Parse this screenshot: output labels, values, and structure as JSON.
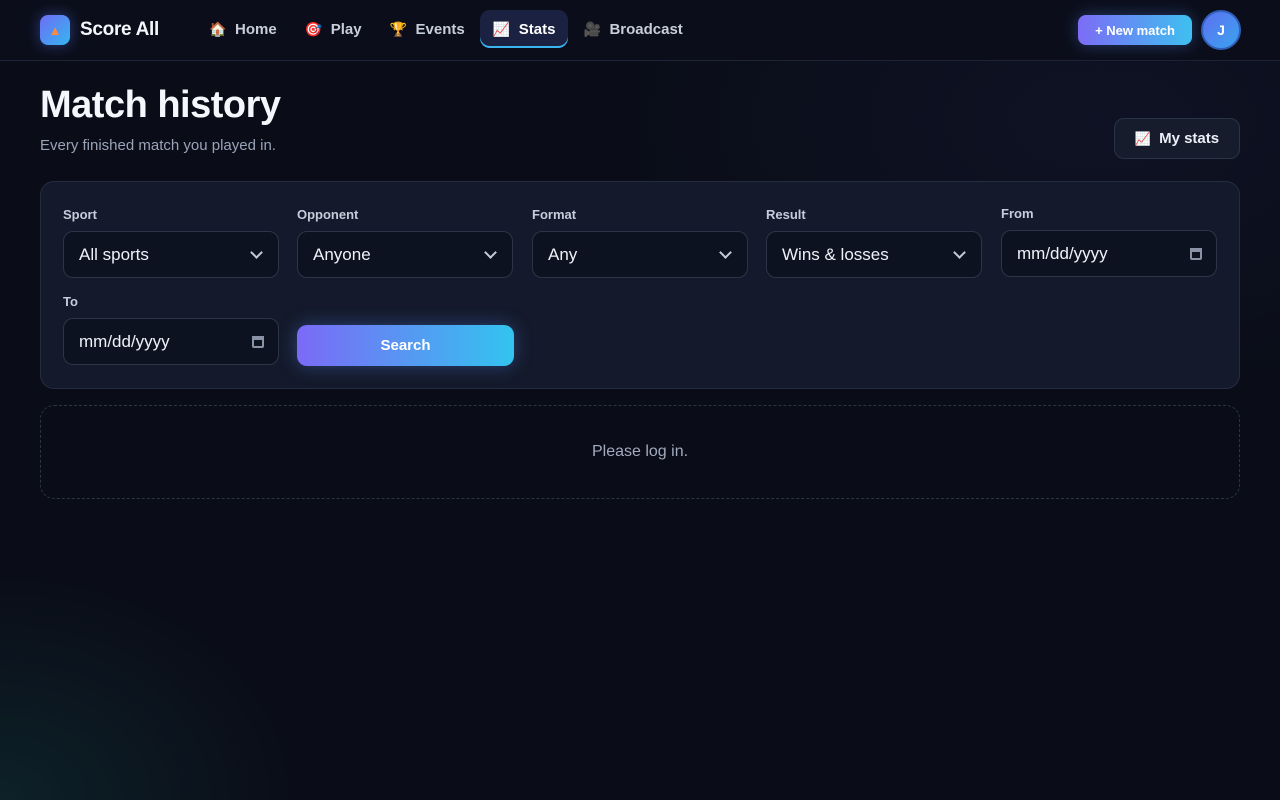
{
  "brand": {
    "name": "Score All",
    "logo_icon": "flame-icon"
  },
  "nav": [
    {
      "label": "Home",
      "icon": "🏠",
      "icon_name": "home-icon",
      "active": false
    },
    {
      "label": "Play",
      "icon": "🎯",
      "icon_name": "target-icon",
      "active": false
    },
    {
      "label": "Events",
      "icon": "🏆",
      "icon_name": "trophy-icon",
      "active": false
    },
    {
      "label": "Stats",
      "icon": "📈",
      "icon_name": "chart-icon",
      "active": true
    },
    {
      "label": "Broadcast",
      "icon": "🎥",
      "icon_name": "camera-icon",
      "active": false
    }
  ],
  "header_actions": {
    "new_match_label": "+ New match",
    "avatar_initial": "J"
  },
  "page": {
    "title": "Match history",
    "subtitle": "Every finished match you played in.",
    "my_stats_label": "My stats",
    "my_stats_icon": "📈"
  },
  "filters": {
    "sport": {
      "label": "Sport",
      "value": "All sports"
    },
    "opponent": {
      "label": "Opponent",
      "value": "Anyone"
    },
    "format": {
      "label": "Format",
      "value": "Any"
    },
    "result": {
      "label": "Result",
      "value": "Wins & losses"
    },
    "from": {
      "label": "From",
      "placeholder": "mm/dd/yyyy"
    },
    "to": {
      "label": "To",
      "placeholder": "mm/dd/yyyy"
    },
    "search_label": "Search"
  },
  "empty_state": {
    "message": "Please log in."
  },
  "colors": {
    "background": "#0a0d18",
    "accent_start": "#7b6af6",
    "accent_end": "#33c4ef",
    "card": "#141a2b"
  }
}
